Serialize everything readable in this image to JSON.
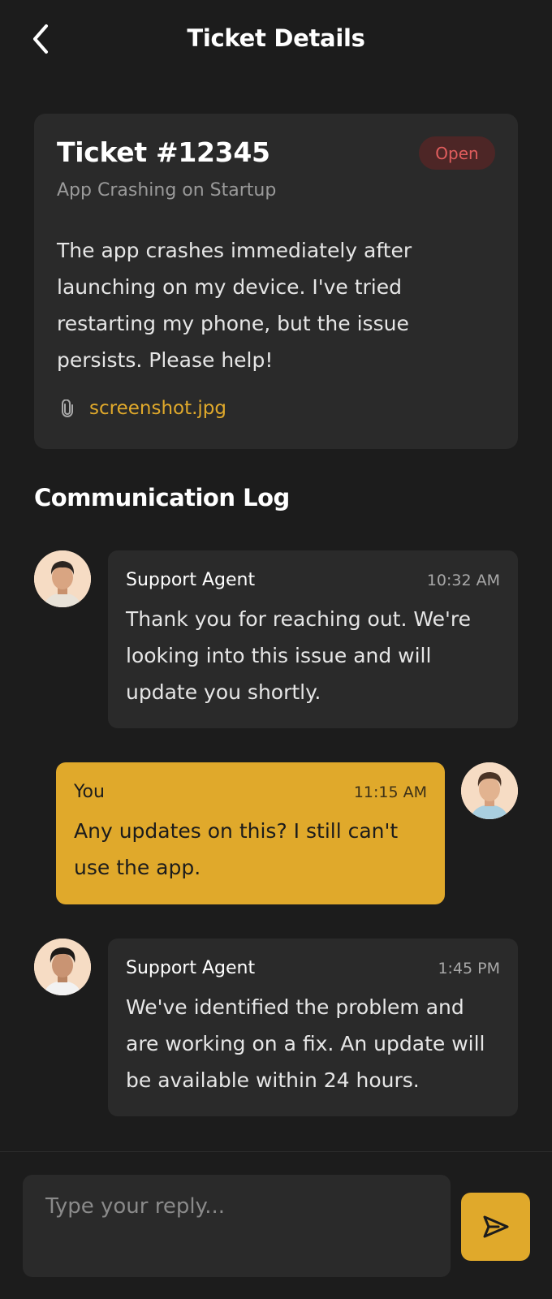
{
  "header": {
    "title": "Ticket Details",
    "back_icon": "chevron-left-icon"
  },
  "ticket": {
    "id": "Ticket #12345",
    "status": "Open",
    "subject": "App Crashing on Startup",
    "description": "The app crashes immediately after launching on my device. I've tried restarting my phone, but the issue persists. Please help!",
    "attachment": {
      "icon": "paperclip-icon",
      "name": "screenshot.jpg"
    }
  },
  "communication": {
    "title": "Communication Log",
    "messages": [
      {
        "sender": "Support Agent",
        "time": "10:32 AM",
        "text": "Thank you for reaching out. We're looking into this issue and will update you shortly."
      },
      {
        "sender": "You",
        "time": "11:15 AM",
        "text": "Any updates on this? I still can't use the app."
      },
      {
        "sender": "Support Agent",
        "time": "1:45 PM",
        "text": "We've identified the problem and are working on a fix. An update will be available within 24 hours."
      }
    ]
  },
  "reply": {
    "placeholder": "Type your reply...",
    "send_icon": "send-icon"
  },
  "colors": {
    "background": "#1c1c1c",
    "card": "#2a2a2a",
    "accent": "#e0a92b",
    "status_open_bg": "#4d2626",
    "status_open_text": "#e05d5d"
  }
}
